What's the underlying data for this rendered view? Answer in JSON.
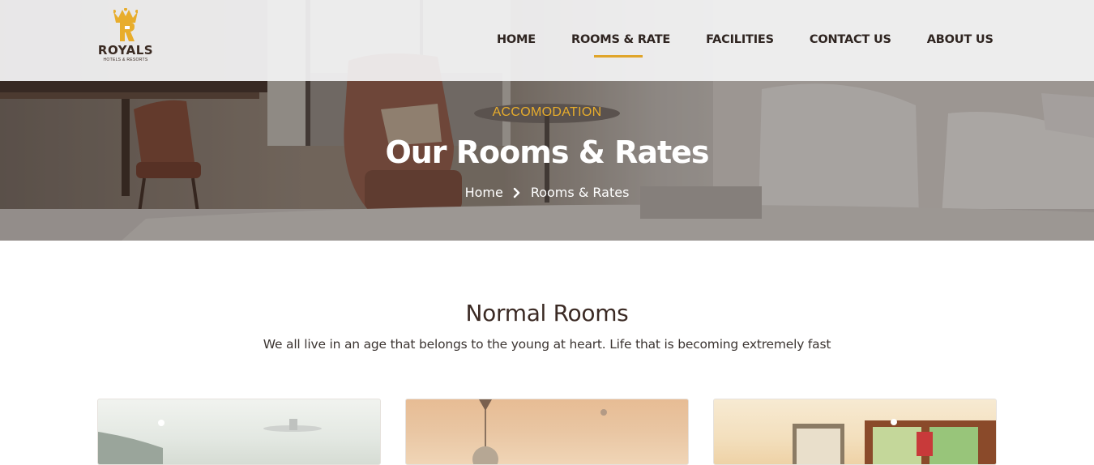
{
  "brand": {
    "name": "ROYALS",
    "tagline": "HOTELS & RESORTS",
    "accent_color": "#e8ad2c"
  },
  "nav": {
    "items": [
      {
        "label": "HOME"
      },
      {
        "label": "ROOMS & RATE",
        "active": true
      },
      {
        "label": "FACILITIES"
      },
      {
        "label": "CONTACT US"
      },
      {
        "label": "ABOUT US"
      }
    ]
  },
  "hero": {
    "eyebrow": "ACCOMODATION",
    "title": "Our Rooms & Rates",
    "breadcrumb": {
      "home": "Home",
      "separator_icon": "chevron-right-icon",
      "current": "Rooms & Rates"
    }
  },
  "section": {
    "title": "Normal Rooms",
    "subtitle": "We all live in an age that belongs to the young at heart. Life that is becoming extremely fast"
  },
  "cards": [
    {
      "image": "room-photo-white-ceiling-fan"
    },
    {
      "image": "room-photo-pendant-lamp"
    },
    {
      "image": "room-photo-framed-picture-window"
    }
  ]
}
